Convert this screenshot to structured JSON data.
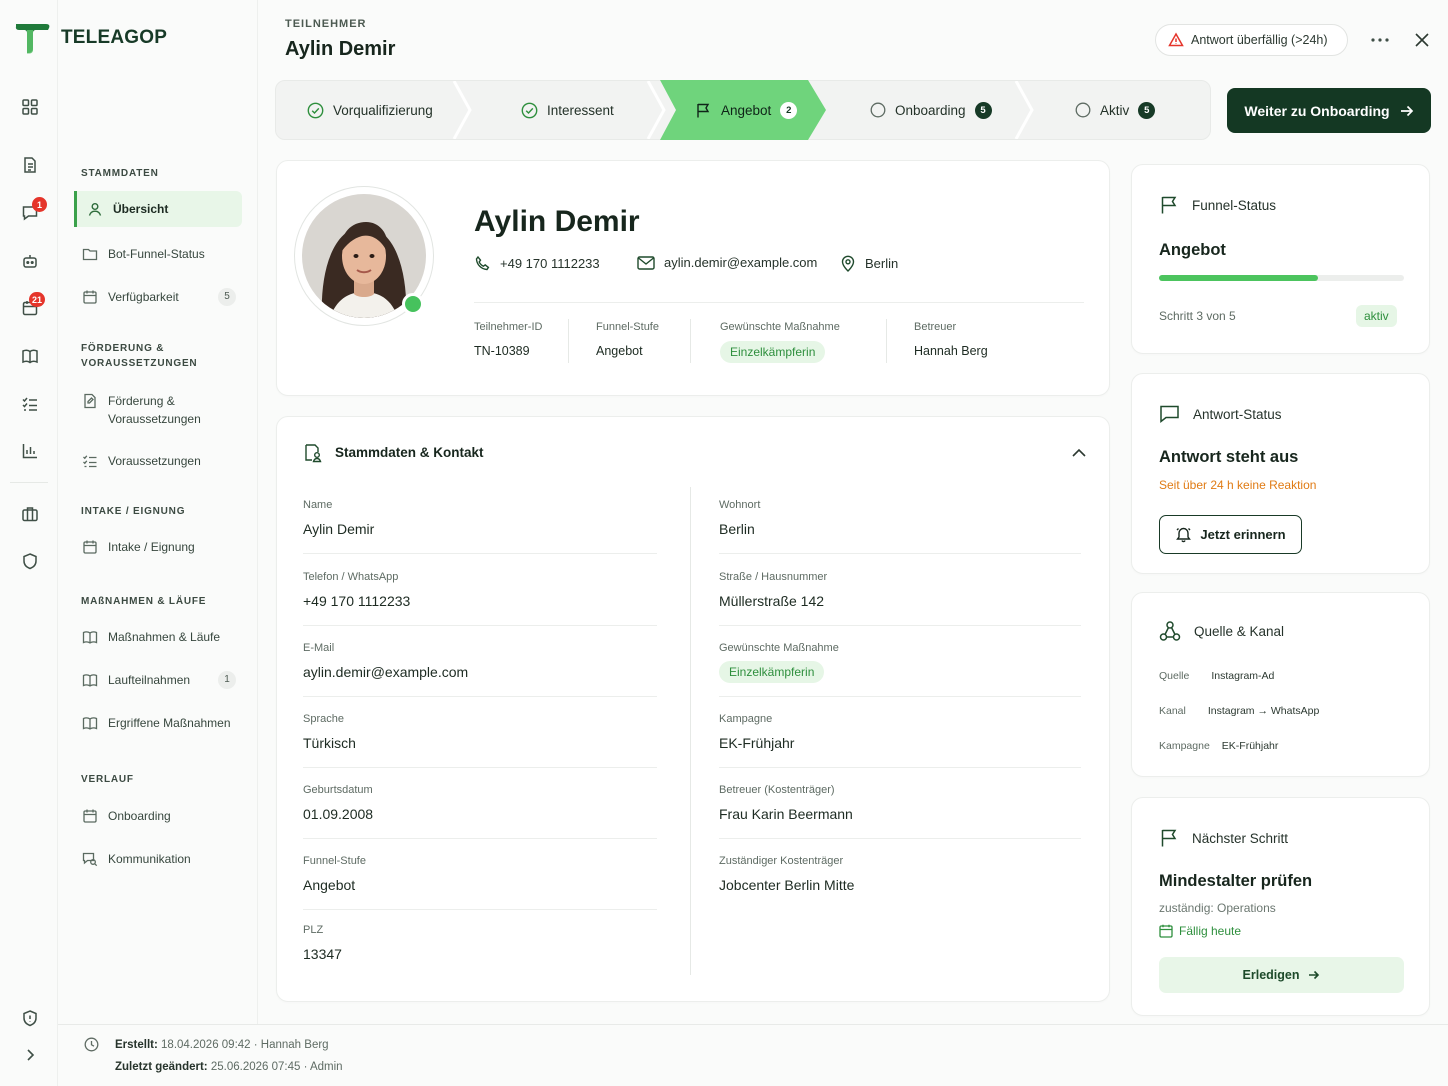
{
  "app": {
    "brand": "TELEAGOP"
  },
  "rail": {
    "badges": {
      "messages": "1",
      "calendar": "21"
    },
    "icons": [
      "dashboard-icon",
      "document-icon",
      "chat-icon",
      "bot-icon",
      "calendar-icon",
      "book-icon",
      "checklist-icon",
      "chart-icon",
      "briefcase-icon",
      "shield-icon",
      "shield-alert-icon",
      "chevron-right-icon"
    ]
  },
  "subnav": {
    "sections": {
      "stammdaten": "STAMMDATEN",
      "foerderung": "FÖRDERUNG & VORAUSSETZUNGEN",
      "intake": "INTAKE / EIGNUNG",
      "massnahmen": "MAßNAHMEN & LÄUFE",
      "verlauf": "VERLAUF"
    },
    "items": [
      {
        "label": "Übersicht"
      },
      {
        "label": "Bot-Funnel-Status"
      },
      {
        "label": "Verfügbarkeit",
        "count": "5"
      },
      {
        "label": "Förderung & Voraussetzungen"
      },
      {
        "label": "Voraussetzungen"
      },
      {
        "label": "Intake / Eignung"
      },
      {
        "label": "Maßnahmen & Läufe"
      },
      {
        "label": "Laufteilnahmen",
        "count": "1"
      },
      {
        "label": "Ergriffene Maßnahmen"
      },
      {
        "label": "Onboarding"
      },
      {
        "label": "Kommunikation"
      }
    ]
  },
  "header": {
    "label": "TEILNEHMER",
    "name": "Aylin Demir",
    "alert": "Antwort überfällig (>24h)"
  },
  "stepper": {
    "steps": [
      {
        "label": "Vorqualifizierung",
        "state": "done"
      },
      {
        "label": "Interessent",
        "state": "done"
      },
      {
        "label": "Angebot",
        "state": "active",
        "count": "2"
      },
      {
        "label": "Onboarding",
        "state": "todo",
        "count": "5"
      },
      {
        "label": "Aktiv",
        "state": "todo",
        "count": "5"
      }
    ],
    "next_button": "Weiter zu Onboarding"
  },
  "profile": {
    "name": "Aylin Demir",
    "phone": "+49 170 1112233",
    "email": "aylin.demir@example.com",
    "city": "Berlin",
    "meta": [
      {
        "label": "Teilnehmer-ID",
        "value": "TN-10389"
      },
      {
        "label": "Funnel-Stufe",
        "value": "Angebot"
      },
      {
        "label": "Gewünschte Maßnahme",
        "value": "Einzelkämpferin"
      },
      {
        "label": "Betreuer",
        "value": "Hannah Berg"
      }
    ]
  },
  "stammdaten": {
    "title": "Stammdaten & Kontakt",
    "left": [
      {
        "label": "Name",
        "value": "Aylin Demir"
      },
      {
        "label": "Telefon / WhatsApp",
        "value": "+49 170 1112233"
      },
      {
        "label": "E-Mail",
        "value": "aylin.demir@example.com"
      },
      {
        "label": "Sprache",
        "value": "Türkisch"
      },
      {
        "label": "Geburtsdatum",
        "value": "01.09.2008"
      },
      {
        "label": "Funnel-Stufe",
        "value": "Angebot"
      },
      {
        "label": "PLZ",
        "value": "13347"
      }
    ],
    "right": [
      {
        "label": "Wohnort",
        "value": "Berlin"
      },
      {
        "label": "Straße / Hausnummer",
        "value": "Müllerstraße 142"
      },
      {
        "label": "Gewünschte Maßnahme",
        "value": "Einzelkämpferin"
      },
      {
        "label": "Kampagne",
        "value": "EK-Frühjahr"
      },
      {
        "label": "Betreuer (Kostenträger)",
        "value": "Frau Karin Beermann"
      },
      {
        "label": "Zuständiger Kostenträger",
        "value": "Jobcenter Berlin Mitte"
      }
    ]
  },
  "funnel_status": {
    "title": "Funnel-Status",
    "stage": "Angebot",
    "progress": 0.65,
    "step_text": "Schritt 3 von 5",
    "status": "aktiv"
  },
  "answer_status": {
    "title": "Antwort-Status",
    "headline": "Antwort steht aus",
    "sub": "Seit über 24 h keine Reaktion",
    "button": "Jetzt erinnern"
  },
  "source": {
    "title": "Quelle & Kanal",
    "rows": [
      {
        "key": "Quelle",
        "value": "Instagram-Ad"
      },
      {
        "key": "Kanal",
        "value": "Instagram → WhatsApp"
      },
      {
        "key": "Kampagne",
        "value": "EK-Frühjahr"
      }
    ]
  },
  "next_step": {
    "title": "Nächster Schritt",
    "headline": "Mindestalter prüfen",
    "owner": "zuständig: Operations",
    "due": "Fällig heute",
    "button": "Erledigen"
  },
  "footer": {
    "created_label": "Erstellt:",
    "created_value": "18.04.2026 09:42",
    "created_by": "Hannah Berg",
    "changed_label": "Zuletzt geändert:",
    "changed_value": "25.06.2026 07:45",
    "changed_by": "Admin"
  },
  "colors": {
    "accent": "#4cc45e",
    "dark": "#143823",
    "warning": "#e07b14",
    "badge": "#e5352b"
  }
}
